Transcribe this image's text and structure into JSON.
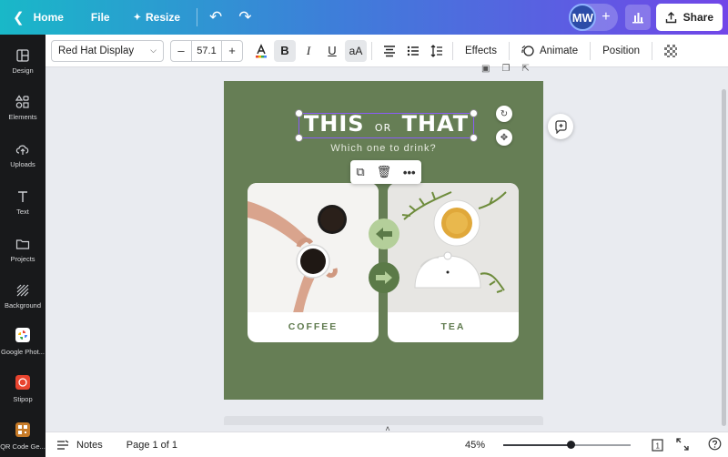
{
  "topbar": {
    "home_label": "Home",
    "file_label": "File",
    "resize_label": "Resize",
    "avatar_initials": "MW",
    "share_label": "Share"
  },
  "sidebar": {
    "items": [
      {
        "label": "Design",
        "icon": "layout-icon"
      },
      {
        "label": "Elements",
        "icon": "shapes-icon"
      },
      {
        "label": "Uploads",
        "icon": "cloud-upload-icon"
      },
      {
        "label": "Text",
        "icon": "text-icon"
      },
      {
        "label": "Projects",
        "icon": "folder-icon"
      },
      {
        "label": "Background",
        "icon": "pattern-icon"
      },
      {
        "label": "Google Phot...",
        "icon": "google-photos-icon"
      },
      {
        "label": "Stipop",
        "icon": "stipop-icon"
      },
      {
        "label": "QR Code Ge...",
        "icon": "qr-code-icon"
      }
    ]
  },
  "toolbar": {
    "font_family": "Red Hat Display",
    "font_size": "57.1",
    "case_label": "aA",
    "effects_label": "Effects",
    "animate_label": "Animate",
    "position_label": "Position"
  },
  "design": {
    "title_this": "THIS",
    "title_or": "OR",
    "title_that": "THAT",
    "subtitle": "Which one to drink?",
    "left_label": "COFFEE",
    "right_label": "TEA"
  },
  "bottombar": {
    "notes_label": "Notes",
    "page_label": "Page 1 of 1",
    "zoom_label": "45%",
    "zoom_fraction": 0.45,
    "page_count": "1"
  },
  "colors": {
    "page_bg": "#667e55",
    "accent_green": "#5f7a4e",
    "arrow_light": "#b4cf9a",
    "arrow_dark": "#5b7a48",
    "selection": "#8a5cf6"
  }
}
